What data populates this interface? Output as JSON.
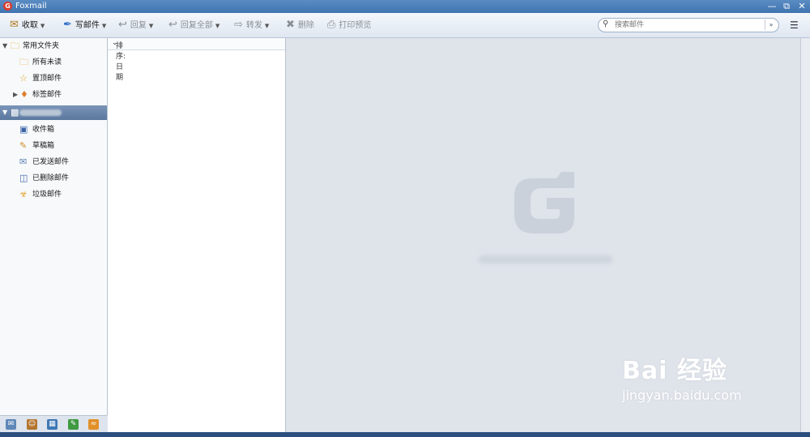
{
  "window": {
    "title": "Foxmail",
    "app_icon": "G"
  },
  "toolbar": {
    "receive": "收取",
    "compose": "写邮件",
    "reply": "回复",
    "reply_all": "回复全部",
    "forward": "转发",
    "delete": "删除",
    "print_preview": "打印预览"
  },
  "search": {
    "placeholder": "搜索邮件"
  },
  "sidebar": {
    "favorites_header": "常用文件夹",
    "favorites": [
      "所有未读",
      "置顶邮件",
      "标签邮件"
    ],
    "account_folders": [
      "收件箱",
      "草稿箱",
      "已发送邮件",
      "已删除邮件",
      "垃圾邮件"
    ]
  },
  "list": {
    "sort_label": "排序:日期"
  },
  "watermark": {
    "main": "Bai 经验",
    "sub": "jingyan.baidu.com"
  },
  "colors": {
    "titlebar": "#4a7fb8",
    "account_highlight": "#6784aa",
    "reading_bg": "#dfe3ea",
    "logo": "#cbd1da"
  },
  "icons": {
    "receive": "inbox-tray-icon",
    "compose": "pen-icon",
    "reply": "reply-arrow-icon",
    "reply_all": "reply-all-icon",
    "forward": "forward-arrow-icon",
    "delete": "scissors-icon",
    "print": "printer-icon",
    "search": "search-icon"
  }
}
